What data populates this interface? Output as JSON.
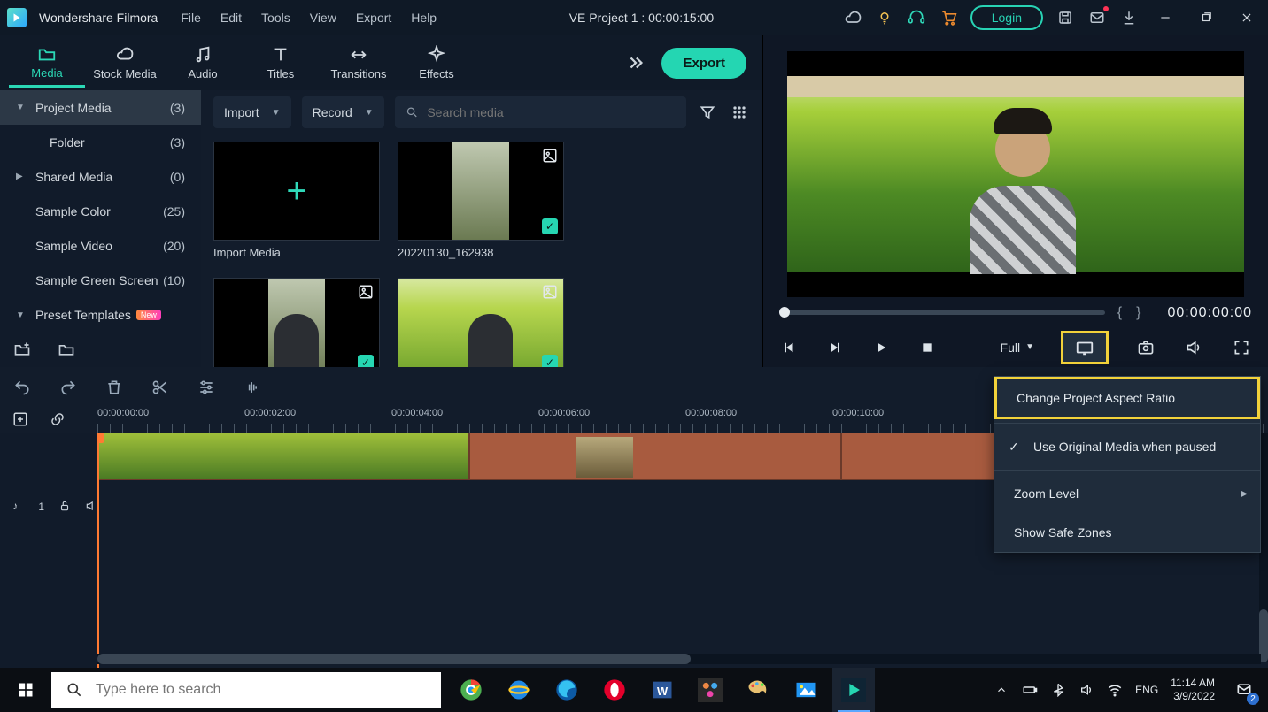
{
  "app": {
    "name": "Wondershare Filmora",
    "project_title": "VE Project 1 : 00:00:15:00",
    "login": "Login"
  },
  "menu": {
    "file": "File",
    "edit": "Edit",
    "tools": "Tools",
    "view": "View",
    "export": "Export",
    "help": "Help"
  },
  "tabs": {
    "media": "Media",
    "stock": "Stock Media",
    "audio": "Audio",
    "titles": "Titles",
    "transitions": "Transitions",
    "effects": "Effects",
    "export_btn": "Export"
  },
  "sidebar": {
    "items": [
      {
        "label": "Project Media",
        "count": "(3)"
      },
      {
        "label": "Folder",
        "count": "(3)"
      },
      {
        "label": "Shared Media",
        "count": "(0)"
      },
      {
        "label": "Sample Color",
        "count": "(25)"
      },
      {
        "label": "Sample Video",
        "count": "(20)"
      },
      {
        "label": "Sample Green Screen",
        "count": "(10)"
      },
      {
        "label": "Preset Templates",
        "count": ""
      }
    ],
    "new_badge": "New"
  },
  "media_toolbar": {
    "import": "Import",
    "record": "Record",
    "search_placeholder": "Search media"
  },
  "media_items": [
    {
      "caption": "Import Media"
    },
    {
      "caption": "20220130_162938"
    },
    {
      "caption": ""
    },
    {
      "caption": ""
    }
  ],
  "preview": {
    "progress_time": "00:00:00:00",
    "quality": "Full"
  },
  "ctx_menu": {
    "change_ratio": "Change Project Aspect Ratio",
    "use_original": "Use Original Media when paused",
    "zoom": "Zoom Level",
    "safe": "Show Safe Zones"
  },
  "ruler": [
    "00:00:00:00",
    "00:00:02:00",
    "00:00:04:00",
    "00:00:06:00",
    "00:00:08:00",
    "00:00:10:00"
  ],
  "audio_track": {
    "label": "1"
  },
  "taskbar": {
    "search_placeholder": "Type here to search",
    "lang": "ENG",
    "time": "11:14 AM",
    "date": "3/9/2022",
    "notif_count": "2"
  }
}
